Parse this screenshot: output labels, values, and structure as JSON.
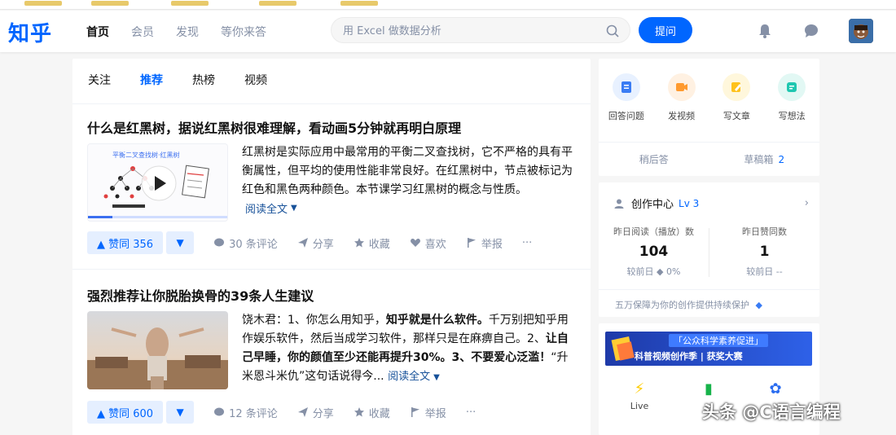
{
  "header": {
    "logo": "知乎",
    "nav": [
      "首页",
      "会员",
      "发现",
      "等你来答"
    ],
    "search_placeholder": "用 Excel 做数据分析",
    "ask_label": "提问"
  },
  "feed": {
    "tabs": [
      "关注",
      "推荐",
      "热榜",
      "视频"
    ],
    "items": [
      {
        "title": "什么是红黑树，据说红黑树很难理解，看动画5分钟就再明白原理",
        "thumb_caption": "平衡二叉查找树·红黑树",
        "excerpt": "红黑树是实际应用中最常用的平衡二叉查找树，它不严格的具有平衡属性，但平均的使用性能非常良好。在红黑树中，节点被标记为红色和黑色两种颜色。本节课学习红黑树的概念与性质。",
        "readmore": "阅读全文",
        "vote": "▲ 赞同 356",
        "comments": "30 条评论",
        "share": "分享",
        "favorite": "收藏",
        "like": "喜欢",
        "report": "举报",
        "more": "···"
      },
      {
        "title": "强烈推荐让你脱胎换骨的39条人生建议",
        "excerpt_lead": "饶木君：1、你怎么用知乎，",
        "excerpt_bold1": "知乎就是什么软件。",
        "excerpt_mid": "千万别把知乎用作娱乐软件，然后当成学习软件，那样只是在麻痹自己。2、",
        "excerpt_bold2": "让自己早睡，你的颜值至少还能再提升30%。3、不要爱心泛滥！",
        "excerpt_tail": "“升米恩斗米仇”这句话说得今...",
        "readmore": "阅读全文",
        "vote": "▲ 赞同 600",
        "comments": "12 条评论",
        "share": "分享",
        "favorite": "收藏",
        "report": "举报",
        "more": "···"
      }
    ]
  },
  "sidebar": {
    "quick": [
      "回答问题",
      "发视频",
      "写文章",
      "写想法"
    ],
    "drafts": {
      "answers_label": "稍后答",
      "drafts_label": "草稿箱",
      "drafts_count": "2"
    },
    "creator": {
      "title": "创作中心",
      "level": "Lv 3",
      "stat1_label": "昨日阅读（播放）数",
      "stat1_value": "104",
      "stat1_compare": "较前日 ◆ 0%",
      "stat2_label": "昨日赞同数",
      "stat2_value": "1",
      "stat2_compare": "较前日 --",
      "footer": "五万保障为你的创作提供持续保护"
    },
    "banner": {
      "line1": "「公众科学素养促进」",
      "line2": "科普视频创作季 | 获奖大赛"
    },
    "mini": [
      "Live",
      "",
      ""
    ]
  },
  "watermark": "头条 @C语言编程",
  "colors": {
    "brand": "#0066ff",
    "text": "#121212",
    "muted": "#8590a6"
  }
}
